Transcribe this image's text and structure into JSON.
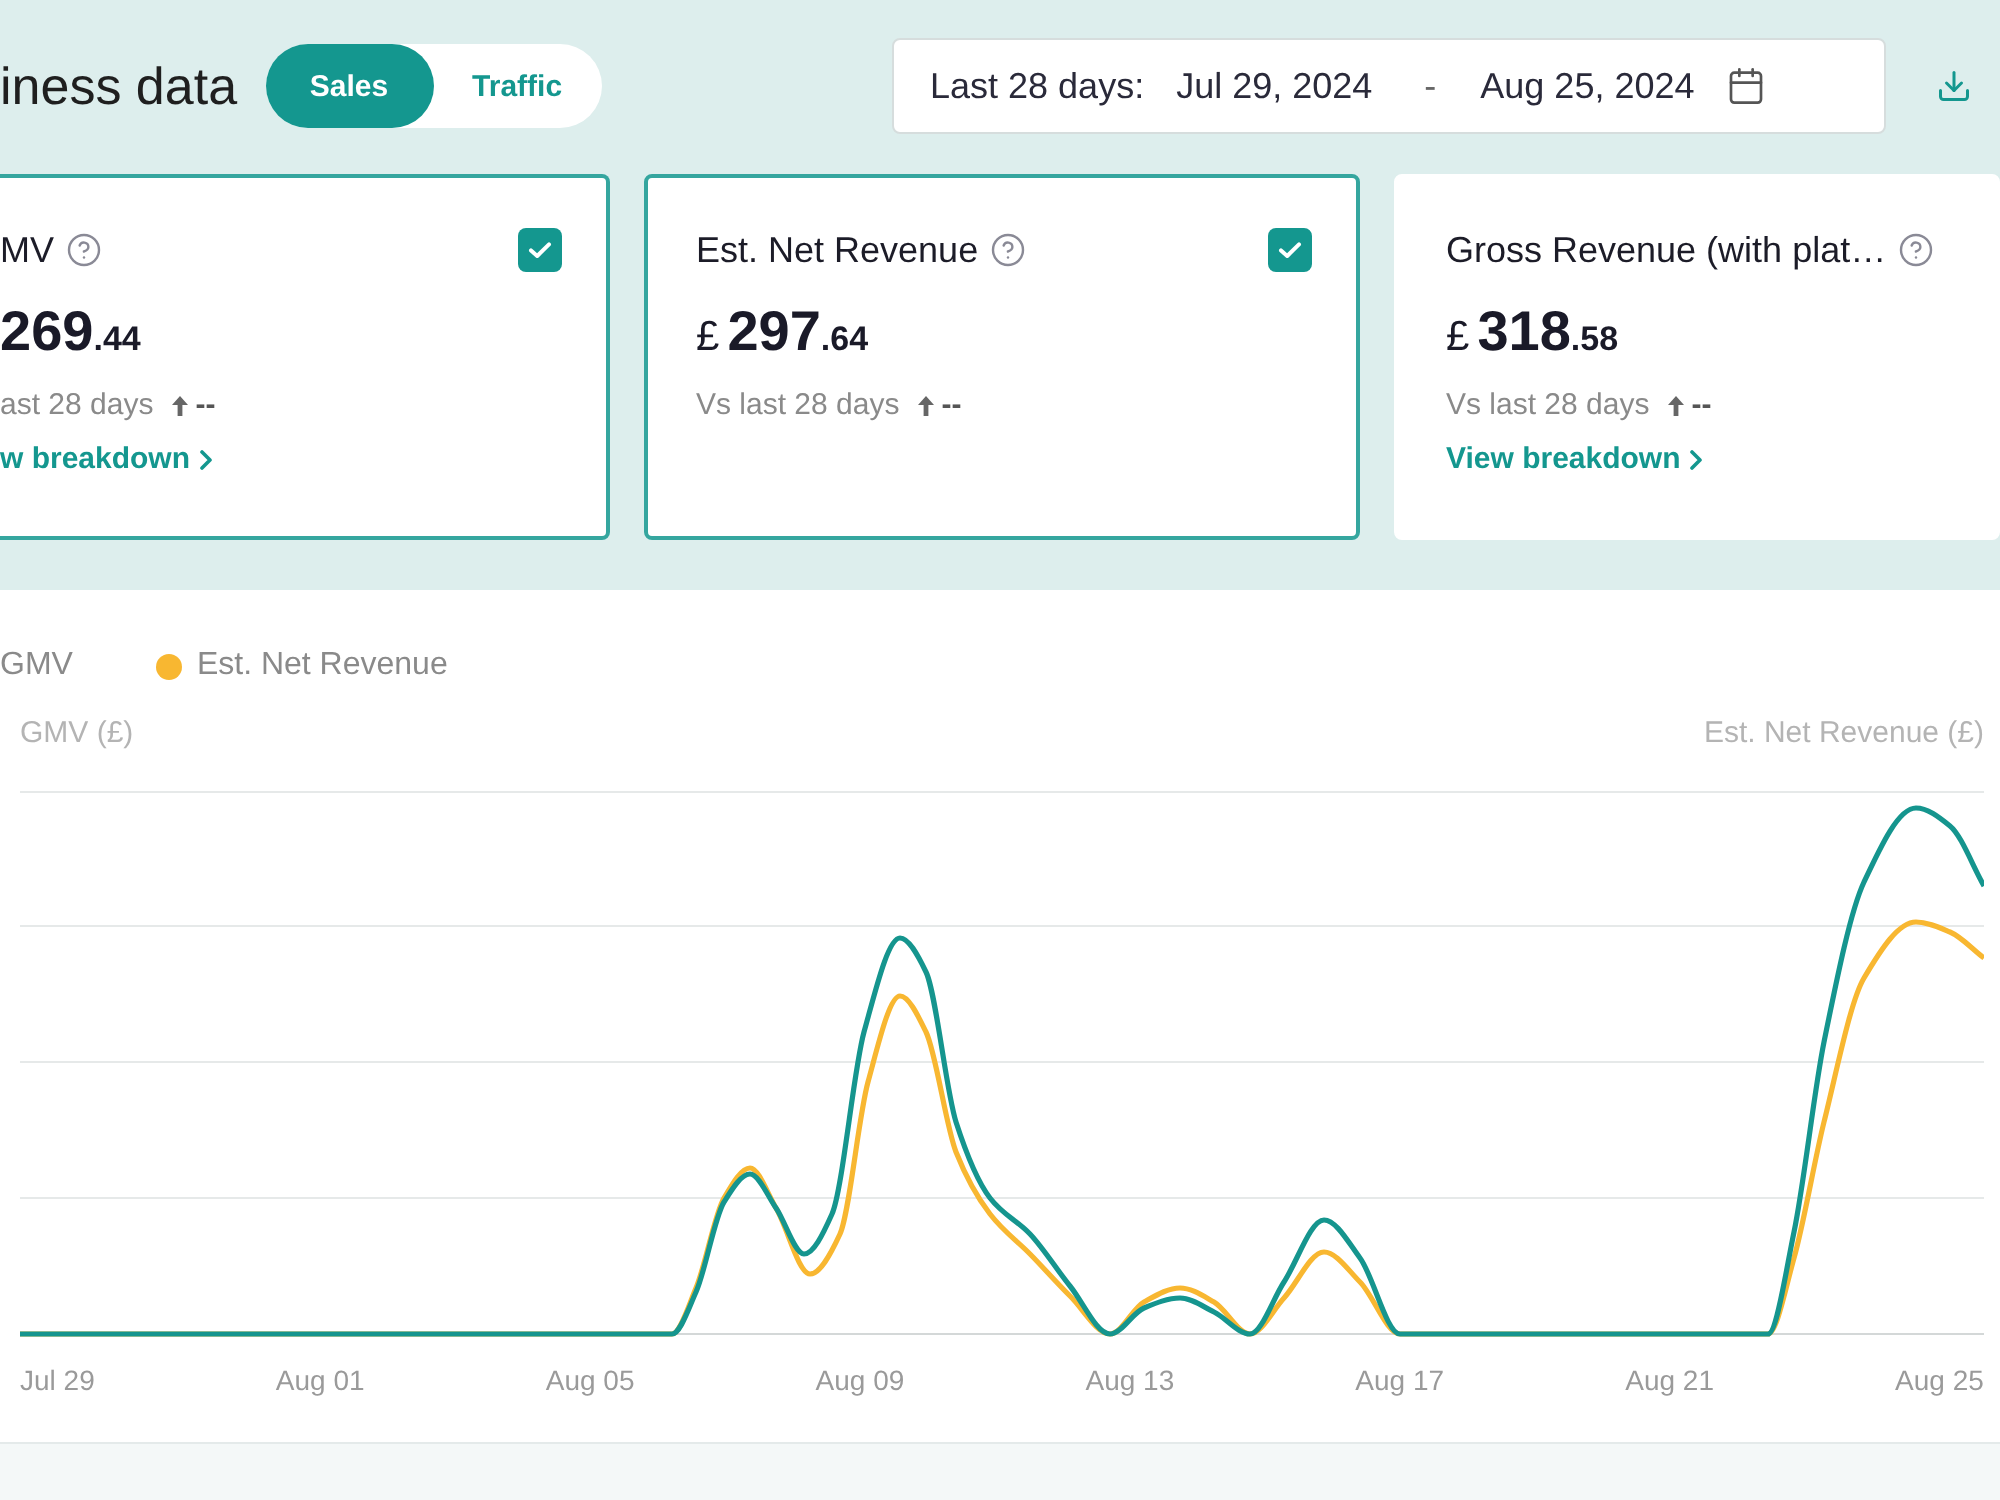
{
  "header": {
    "title": "iness data",
    "tabs": [
      {
        "label": "Sales",
        "selected": true
      },
      {
        "label": "Traffic",
        "selected": false
      }
    ],
    "date_range": {
      "label": "Last 28 days:",
      "start": "Jul 29, 2024",
      "separator": "-",
      "end": "Aug 25, 2024"
    }
  },
  "metrics": [
    {
      "title": "MV",
      "amount": "269",
      "decimals": ".44",
      "comparison": "ast 28 days",
      "change": "--",
      "link": "w breakdown",
      "checked": true
    },
    {
      "title": "Est. Net Revenue",
      "currency": "£",
      "amount": "297",
      "decimals": ".64",
      "comparison": "Vs last 28 days",
      "change": "--",
      "checked": true
    },
    {
      "title": "Gross Revenue (with plat…",
      "currency": "£",
      "amount": "318",
      "decimals": ".58",
      "comparison": "Vs last 28 days",
      "change": "--",
      "link": "View breakdown",
      "checked": false
    }
  ],
  "chart": {
    "legend": [
      {
        "label": "GMV"
      },
      {
        "label": "Est. Net Revenue",
        "color": "#f8b731"
      }
    ],
    "y_left_title": "GMV (£)",
    "y_right_title": "Est. Net Revenue (£)",
    "x_labels": [
      "Jul 29",
      "Aug 01",
      "Aug 05",
      "Aug 09",
      "Aug 13",
      "Aug 17",
      "Aug 21",
      "Aug 25"
    ]
  }
}
